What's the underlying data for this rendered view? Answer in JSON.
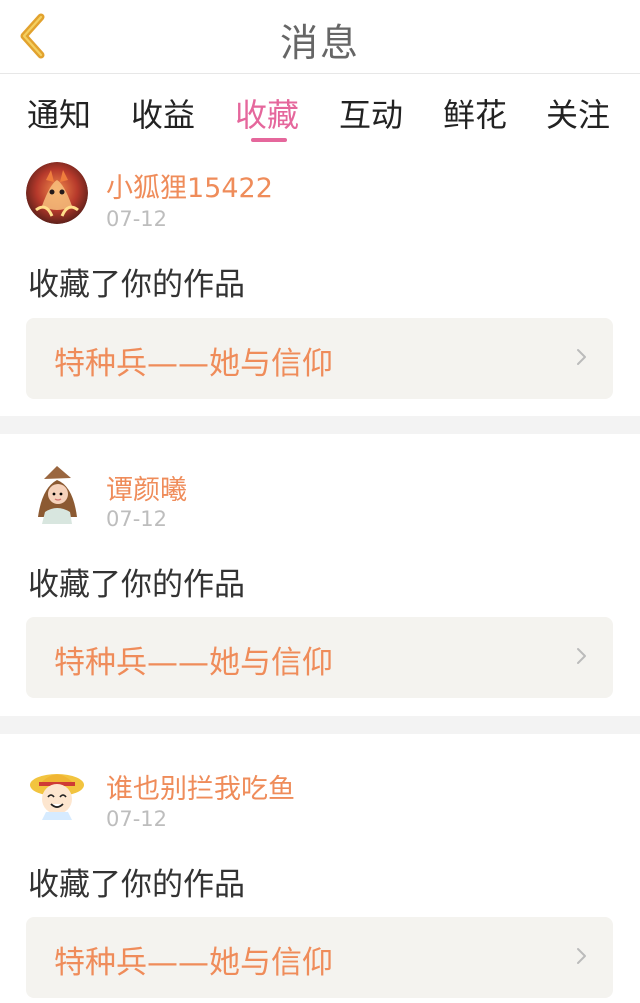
{
  "header": {
    "title": "消息",
    "back_icon": "chevron-left-icon"
  },
  "tabs": [
    {
      "label": "通知"
    },
    {
      "label": "收益"
    },
    {
      "label": "收藏",
      "active": true
    },
    {
      "label": "互动"
    },
    {
      "label": "鲜花"
    },
    {
      "label": "关注"
    }
  ],
  "colors": {
    "accent": "#e5679c",
    "name": "#ef8c5a",
    "card_bg": "#f4f3ef"
  },
  "items": [
    {
      "username": "小狐狸15422",
      "date": "07-12",
      "message": "收藏了你的作品",
      "work_title": "特种兵——她与信仰",
      "avatar_icon": "fox-avatar-icon"
    },
    {
      "username": "谭颜曦",
      "date": "07-12",
      "message": "收藏了你的作品",
      "work_title": "特种兵——她与信仰",
      "avatar_icon": "girl-avatar-icon"
    },
    {
      "username": "谁也别拦我吃鱼",
      "date": "07-12",
      "message": "收藏了你的作品",
      "work_title": "特种兵——她与信仰",
      "avatar_icon": "straw-hat-avatar-icon"
    }
  ]
}
